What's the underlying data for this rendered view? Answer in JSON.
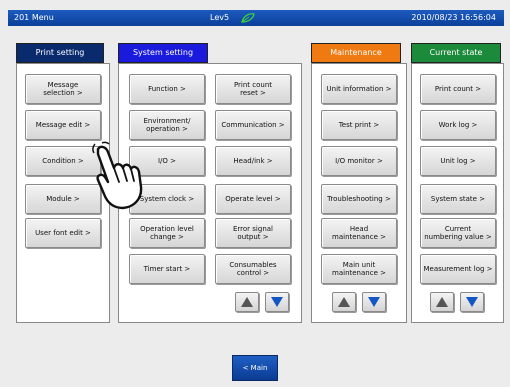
{
  "titlebar": {
    "menu_label": "201 Menu",
    "level": "Lev5",
    "datetime": "2010/08/23 16:56:04"
  },
  "tabs": {
    "print_setting": "Print setting",
    "system_setting": "System setting",
    "maintenance": "Maintenance",
    "current_state": "Current state"
  },
  "print_setting": {
    "message_selection": "Message\nselection >",
    "message_edit": "Message edit >",
    "condition": "Condition >",
    "module": "Module >",
    "user_font_edit": "User font edit >"
  },
  "system_setting": {
    "function": "Function >",
    "print_count_reset": "Print count\nreset >",
    "environment_operation": "Environment/\noperation >",
    "communication": "Communication >",
    "io": "I/O >",
    "head_ink": "Head/ink >",
    "system_clock": "System clock >",
    "operate_level": "Operate level >",
    "operation_level_change": "Operation level\nchange >",
    "error_signal_output": "Error signal\noutput >",
    "timer_start": "Timer start >",
    "consumables_control": "Consumables\ncontrol >"
  },
  "maintenance": {
    "unit_information": "Unit information >",
    "test_print": "Test print >",
    "io_monitor": "I/O monitor >",
    "troubleshooting": "Troubleshooting >",
    "head_maintenance": "Head\nmaintenance >",
    "main_unit_maintenance": "Main unit\nmaintenance >"
  },
  "current_state": {
    "print_count": "Print count >",
    "work_log": "Work log >",
    "unit_log": "Unit log >",
    "system_state": "System state >",
    "current_numbering_value": "Current\nnumbering value >",
    "measurement_log": "Measurement log >"
  },
  "footer": {
    "main_label": "< Main"
  },
  "colors": {
    "titlebar": "#0b3f9a",
    "tab_print": "#0a2a6e",
    "tab_system": "#1a1adc",
    "tab_maintenance": "#ef7a12",
    "tab_current": "#1b8a3a",
    "arrow_up": "#555555",
    "arrow_down": "#1456c4"
  },
  "icons": {
    "leaf": "leaf-icon",
    "pointer": "hand-pointer-icon"
  }
}
